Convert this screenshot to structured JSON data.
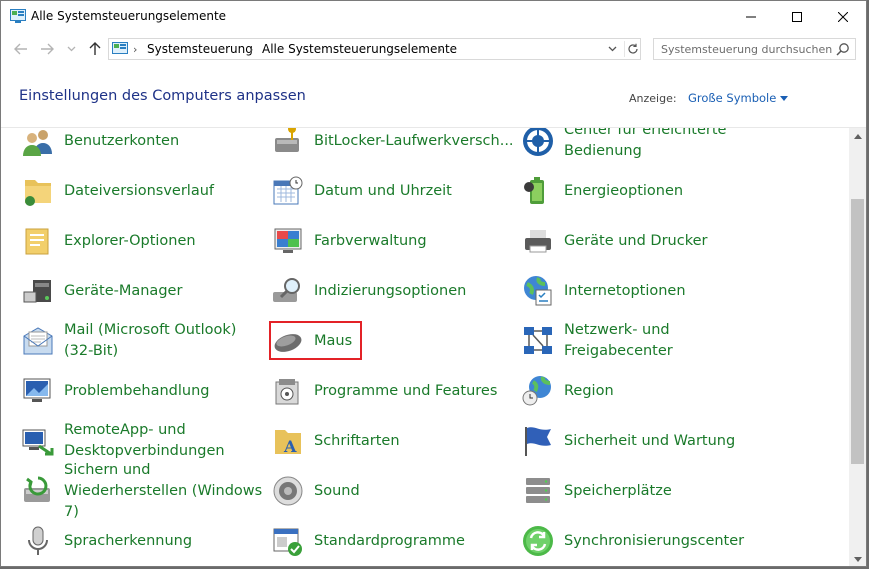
{
  "window": {
    "title": "Alle Systemsteuerungselemente"
  },
  "address": {
    "crumbs": [
      "Systemsteuerung",
      "Alle Systemsteuerungselemente"
    ]
  },
  "search": {
    "placeholder": "Systemsteuerung durchsuchen"
  },
  "header": {
    "title": "Einstellungen des Computers anpassen",
    "view_label": "Anzeige:",
    "view_value": "Große Symbole"
  },
  "items": [
    {
      "label": "Benutzerkonten",
      "icon": "user-accounts-icon"
    },
    {
      "label": "BitLocker-Laufwerkversch...",
      "icon": "bitlocker-icon"
    },
    {
      "label": "Center für erleichterte Bedienung",
      "icon": "ease-of-access-icon"
    },
    {
      "label": "Dateiversionsverlauf",
      "icon": "file-history-icon"
    },
    {
      "label": "Datum und Uhrzeit",
      "icon": "date-time-icon"
    },
    {
      "label": "Energieoptionen",
      "icon": "power-options-icon"
    },
    {
      "label": "Explorer-Optionen",
      "icon": "explorer-options-icon"
    },
    {
      "label": "Farbverwaltung",
      "icon": "color-management-icon"
    },
    {
      "label": "Geräte und Drucker",
      "icon": "devices-printers-icon"
    },
    {
      "label": "Geräte-Manager",
      "icon": "device-manager-icon"
    },
    {
      "label": "Indizierungsoptionen",
      "icon": "indexing-options-icon"
    },
    {
      "label": "Internetoptionen",
      "icon": "internet-options-icon"
    },
    {
      "label": "Mail (Microsoft Outlook) (32-Bit)",
      "icon": "mail-icon"
    },
    {
      "label": "Maus",
      "icon": "mouse-icon"
    },
    {
      "label": "Netzwerk- und Freigabecenter",
      "icon": "network-sharing-icon"
    },
    {
      "label": "Problembehandlung",
      "icon": "troubleshooting-icon"
    },
    {
      "label": "Programme und Features",
      "icon": "programs-features-icon"
    },
    {
      "label": "Region",
      "icon": "region-icon"
    },
    {
      "label": "RemoteApp- und Desktopverbindungen",
      "icon": "remoteapp-icon"
    },
    {
      "label": "Schriftarten",
      "icon": "fonts-icon"
    },
    {
      "label": "Sicherheit und Wartung",
      "icon": "security-maintenance-icon"
    },
    {
      "label": "Sichern und Wiederherstellen (Windows 7)",
      "icon": "backup-restore-icon"
    },
    {
      "label": "Sound",
      "icon": "sound-icon"
    },
    {
      "label": "Speicherplätze",
      "icon": "storage-spaces-icon"
    },
    {
      "label": "Spracherkennung",
      "icon": "speech-recognition-icon"
    },
    {
      "label": "Standardprogramme",
      "icon": "default-programs-icon"
    },
    {
      "label": "Synchronisierungscenter",
      "icon": "sync-center-icon"
    }
  ],
  "highlighted_item": "Maus",
  "colors": {
    "link_green": "#1a7a2a",
    "title_blue": "#1e3287",
    "highlight_red": "#e32227"
  }
}
